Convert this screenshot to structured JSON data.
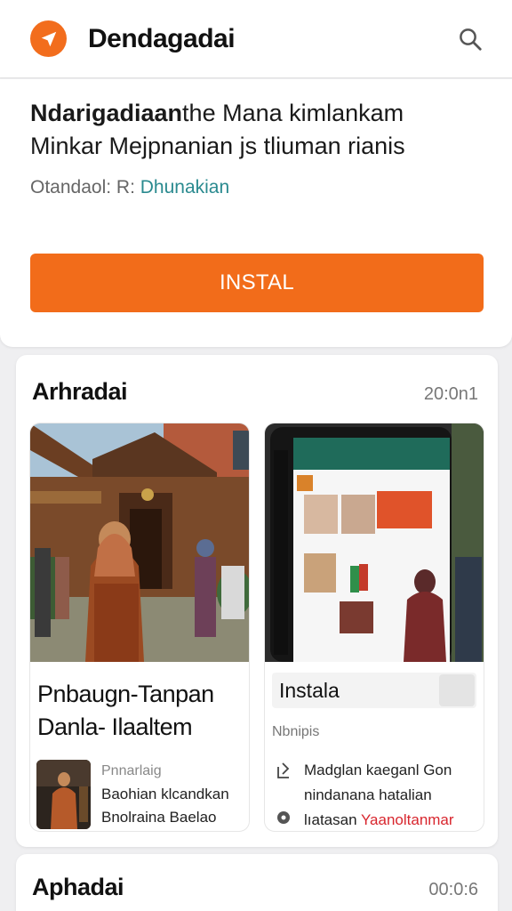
{
  "header": {
    "app_name": "Dendagadai",
    "icons": {
      "logo": "navigation-arrow-icon",
      "search": "search-icon"
    },
    "accent": "#f26d1d"
  },
  "promo": {
    "lead": "Ndarigadiaan",
    "description_rest": "the Mana kimlankam Minkar Mejpnanian js tliuman rianis",
    "meta_label": "Otandaol: R:",
    "meta_developer": "Dhunakian",
    "install_label": "INSTAL"
  },
  "section1": {
    "title": "Arhradai",
    "time": "20:0n1",
    "cards": [
      {
        "image": "woman-in-batik-in-front-of-traditional-house",
        "title": "Pnbaugn-Tanpan Danla- Ilaaltem",
        "sub_caption": "Pnnarlaig",
        "sub_line1": "Baohian klcandkan",
        "sub_line2": "Bnolraina Baelao"
      },
      {
        "image": "phone-app-screenshot",
        "tag_label": "Instala",
        "small_caption": "Nbnipis",
        "line1": "Madglan kaeganl Gon",
        "line2": "nindanana hatalian",
        "line3_prefix": "lıatasan",
        "line3_highlight": "Yaanoltanmar",
        "icons": {
          "first": "share-icon",
          "second": "info-icon"
        }
      }
    ]
  },
  "section2": {
    "title": "Aphadai",
    "time": "00:0:6"
  }
}
